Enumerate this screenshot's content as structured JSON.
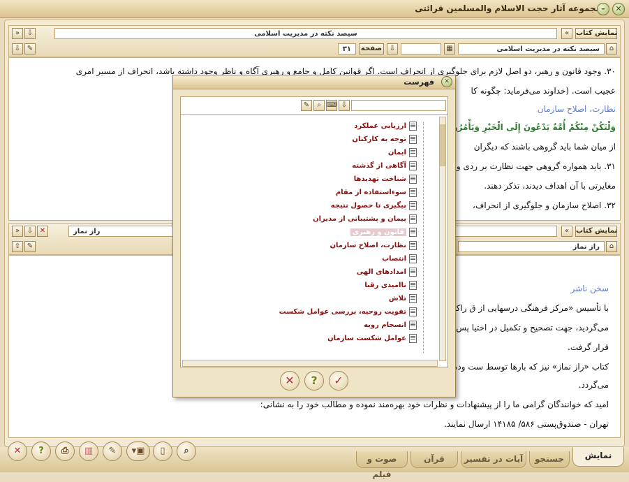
{
  "app": {
    "title": "مجموعه آثار حجت الاسلام والمسلمین قرائتی"
  },
  "top_pane": {
    "show_book_label": "نمایش کتاب",
    "book_title": "سیصد نکته در مدیریت اسلامی",
    "book_field": "سیصد نکته در مدیریت اسلامی",
    "page_label": "صفحه",
    "page_value": "۳۱",
    "lines": [
      "۳۰. وجود قانون و رهبر، دو اصل لازم برای جلوگیری از انحراف است. اگر قوانین کامل و جامع و رهبری آگاه و ناظر وجود داشته باشد، انحراف از مسیر امری",
      "عجیب است. (خداوند می‌فرماید: چگونه کا",
      "نظارت، اصلاح سازمان",
      "وَلْتَكُنْ مِنْكُمْ أُمَّةٌ يَدْعُونَ إِلَى الْخَيْرِ وَيَأْمُرُونَ",
      "از میان شما باید گروهی باشند که دیگران",
      "۳۱. باید همواره گروهی جهت نظارت بر                                                              ردی و سازمانی افراد دقت نمایند تا هر کجا",
      "مغایرتی با آن اهداف دیدند، تذکر دهند.",
      "۳۲. اصلاح سازمان و جلوگیری از انحراف،"
    ]
  },
  "bottom_pane": {
    "show_book_label": "نمایش کتاب",
    "book_title": "راز نماز",
    "book_field": "راز نماز",
    "heading": "سخن ناشر",
    "lines": [
      "با تأسیس «مرکز فرهنگی درسهایی از ق                                                              راکنده توسط ناشران محترم چاپ و منتشر",
      "می‌گردید، جهت تصحیح و تکمیل در اختیا                                                              پس از بازبینی و ویراستاری در مسیر نشر",
      "قرار گرفت.",
      "کتاب «راز نماز» نیز که بارها توسط ست                                                              وده است) از این پس توسّط این مرکز منتشر",
      "می‌گردد.",
      "امید که خوانندگان گرامی ما را از پیشنهادات و نظرات خود بهره‌مند نموده و مطالب خود را به نشانی:",
      "تهران - صندوق‌پستی ۵۸۶/ ۱۴۱۸۵ ارسال نمایند."
    ]
  },
  "dialog": {
    "title": "فهرست",
    "search_value": "",
    "items": [
      "ارزیابی عملکرد",
      "توجه به کارکنان",
      "ایمان",
      "آگاهی از گذشته",
      "شناخت تهدیدها",
      "سوءاستفاده از مقام",
      "پیگیری تا حصول نتیجه",
      "پیمان و پشتیبانی از مدیران",
      "قانون و رهبری",
      "نظارت، اصلاح سازمان",
      "انتصاب",
      "امدادهای الهی",
      "ناامیدی رقبا",
      "تلاش",
      "تقویت روحیه، بررسی عوامل شکست",
      "انسجام رویه",
      "عوامل شکست سازمان"
    ],
    "selected_index": 8
  },
  "tabs": [
    "نمایش",
    "جستجو",
    "آیات در تفسیر",
    "قرآن",
    "صوت و فیلم"
  ],
  "active_tab": 0
}
